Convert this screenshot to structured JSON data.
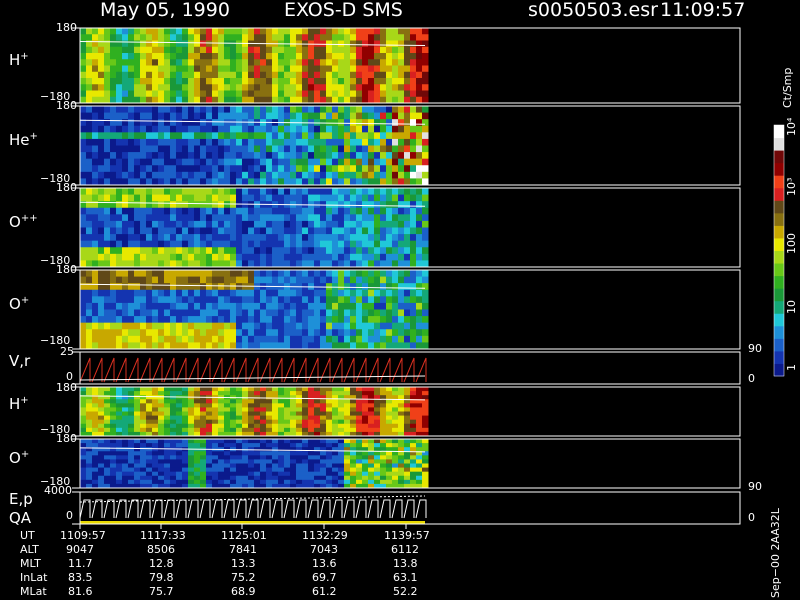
{
  "header": {
    "date": "May 05, 1990",
    "instrument": "EXOS-D SMS",
    "file": "s0050503.esr",
    "time": "11:09:57"
  },
  "panels": [
    {
      "label": "H",
      "sup": "+",
      "top": "180",
      "bottom": "−180"
    },
    {
      "label": "He",
      "sup": "+",
      "top": "180",
      "bottom": "−180"
    },
    {
      "label": "O",
      "sup": "++",
      "top": "180",
      "bottom": "−180"
    },
    {
      "label": "O",
      "sup": "+",
      "top": "180",
      "bottom": "−180"
    },
    {
      "label": "V,r",
      "sup": "",
      "top": "25",
      "bottom": "0",
      "right_top": "90",
      "right_bottom": "0"
    },
    {
      "label": "H",
      "sup": "+",
      "top": "180",
      "bottom": "−180"
    },
    {
      "label": "O",
      "sup": "+",
      "top": "180",
      "bottom": "−180"
    },
    {
      "label": "E,p",
      "sup": "",
      "label2": "QA",
      "top": "4000",
      "bottom": "0",
      "right_top": "90",
      "right_bottom": "0"
    }
  ],
  "colorbar": {
    "unit": "Ct/Smp",
    "ticks": [
      "1",
      "10",
      "100",
      "10³",
      "10⁴"
    ],
    "colors": [
      "#0b1a8c",
      "#1434b0",
      "#1b60c8",
      "#1e90d8",
      "#20c8d8",
      "#14a878",
      "#1a9838",
      "#30b020",
      "#68c818",
      "#a8d818",
      "#e8e800",
      "#c8a800",
      "#887010",
      "#604818",
      "#d82020",
      "#f04018",
      "#900000",
      "#700808",
      "#e0e0e0",
      "#ffffff"
    ]
  },
  "footer": {
    "rows": [
      {
        "name": "UT",
        "values": [
          "1109:57",
          "1117:33",
          "1125:01",
          "1132:29",
          "1139:57"
        ]
      },
      {
        "name": "ALT",
        "values": [
          "9047",
          "8506",
          "7841",
          "7043",
          "6112"
        ]
      },
      {
        "name": "MLT",
        "values": [
          "11.7",
          "12.8",
          "13.3",
          "13.6",
          "13.8"
        ]
      },
      {
        "name": "InLat",
        "values": [
          "83.5",
          "79.8",
          "75.2",
          "69.7",
          "63.1"
        ]
      },
      {
        "name": "MLat",
        "values": [
          "81.6",
          "75.7",
          "68.9",
          "61.2",
          "52.2"
        ]
      }
    ],
    "side_note": "Sep−00 2AA32L"
  },
  "chart_data": {
    "type": "heatmap",
    "title": "May 05, 1990 EXOS-D SMS",
    "x": [
      "1109:57",
      "1117:33",
      "1125:01",
      "1132:29",
      "1139:57"
    ],
    "panels_y_range": {
      "H+": [
        -180,
        180
      ],
      "He+": [
        -180,
        180
      ],
      "O++": [
        -180,
        180
      ],
      "O+": [
        -180,
        180
      ],
      "V,r": [
        0,
        25
      ],
      "E,p": [
        0,
        4000
      ]
    },
    "colorbar_range": [
      1,
      10000
    ],
    "colorbar_unit": "Ct/Smp",
    "data_coverage": "1109:57 to 1139:57"
  }
}
